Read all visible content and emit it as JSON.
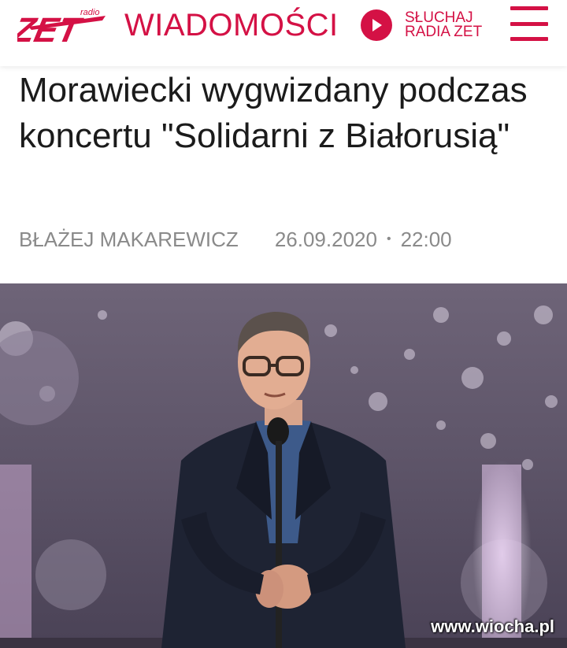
{
  "header": {
    "logo_text": "ZET",
    "logo_superscript": "radio",
    "section_title": "WIADOMOŚCI",
    "listen_line1": "SŁUCHAJ",
    "listen_line2": "RADIA ZET",
    "brand_color": "#d41145"
  },
  "article": {
    "headline": "Morawiecki wygwizdany podczas koncertu \"Solidarni z Białorusią\"",
    "author": "BŁAŻEJ MAKAREWICZ",
    "date": "26.09.2020",
    "separator": "•",
    "time": "22:00"
  },
  "photo": {
    "subject": "man in dark suit and glasses speaking at a microphone on stage",
    "watermark": "www.wiocha.pl"
  },
  "icons": {
    "play": "play-icon",
    "menu": "hamburger-menu-icon"
  }
}
